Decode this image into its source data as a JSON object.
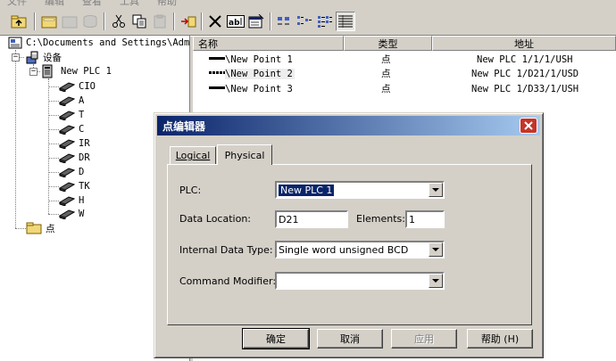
{
  "menubar": {
    "items": [
      "文件",
      "编辑",
      "查看",
      "工具",
      "帮助"
    ]
  },
  "tree": {
    "root": "C:\\Documents and Settings\\Admi",
    "devices": "设备",
    "plc": "New PLC 1",
    "areas": [
      "CIO",
      "A",
      "T",
      "C",
      "IR",
      "DR",
      "D",
      "TK",
      "H",
      "W"
    ],
    "points": "点"
  },
  "list": {
    "columns": [
      "名称",
      "类型",
      "地址"
    ],
    "rows": [
      {
        "name": "\\New Point 1",
        "type": "点",
        "address": "New PLC 1/1/1/USH"
      },
      {
        "name": "\\New Point 2",
        "type": "点",
        "address": "New PLC 1/D21/1/USD"
      },
      {
        "name": "\\New Point 3",
        "type": "点",
        "address": "New PLC 1/D33/1/USH"
      }
    ]
  },
  "dialog": {
    "title": "点编辑器",
    "tabs": [
      "Logical",
      "Physical"
    ],
    "plc_label": "PLC:",
    "plc_value": "New PLC 1",
    "data_location_label": "Data Location:",
    "data_location_value": "D21",
    "elements_label": "Elements:",
    "elements_value": "1",
    "internal_type_label": "Internal Data Type:",
    "internal_type_value": "Single word unsigned BCD",
    "command_modifier_label": "Command Modifier:",
    "command_modifier_value": "",
    "ok_label": "确定",
    "cancel_label": "取消",
    "apply_label": "应用",
    "help_label": "帮助 (H)"
  },
  "colors": {
    "titlebar_start": "#0a246a",
    "titlebar_end": "#a6caf0",
    "selection": "#0a246a",
    "close_button": "#c4352a"
  }
}
